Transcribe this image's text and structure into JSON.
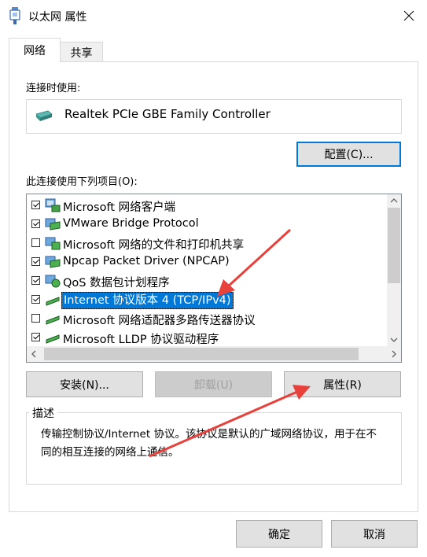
{
  "window": {
    "title": "以太网 属性"
  },
  "tabs": [
    {
      "label": "网络"
    },
    {
      "label": "共享"
    }
  ],
  "connect_using_label": "连接时使用:",
  "adapter": {
    "name": "Realtek PCIe GBE Family Controller"
  },
  "configure_button": "配置(C)...",
  "items_label": "此连接使用下列项目(O):",
  "items": [
    {
      "label": "Microsoft 网络客户端",
      "checked": true
    },
    {
      "label": "VMware Bridge Protocol",
      "checked": true
    },
    {
      "label": "Microsoft 网络的文件和打印机共享",
      "checked": false
    },
    {
      "label": "Npcap Packet Driver (NPCAP)",
      "checked": true
    },
    {
      "label": "QoS 数据包计划程序",
      "checked": true
    },
    {
      "label": "Internet 协议版本 4 (TCP/IPv4)",
      "checked": true,
      "selected": true
    },
    {
      "label": "Microsoft 网络适配器多路传送器协议",
      "checked": false
    },
    {
      "label": "Microsoft LLDP 协议驱动程序",
      "checked": true
    }
  ],
  "buttons": {
    "install": "安装(N)...",
    "uninstall": "卸载(U)",
    "properties": "属性(R)"
  },
  "description": {
    "title": "描述",
    "text": "传输控制协议/Internet 协议。该协议是默认的广域网络协议，用于在不同的相互连接的网络上通信。"
  },
  "footer": {
    "ok": "确定",
    "cancel": "取消"
  },
  "colors": {
    "accent": "#0078d7",
    "annotation_arrow": "#e8403a"
  }
}
